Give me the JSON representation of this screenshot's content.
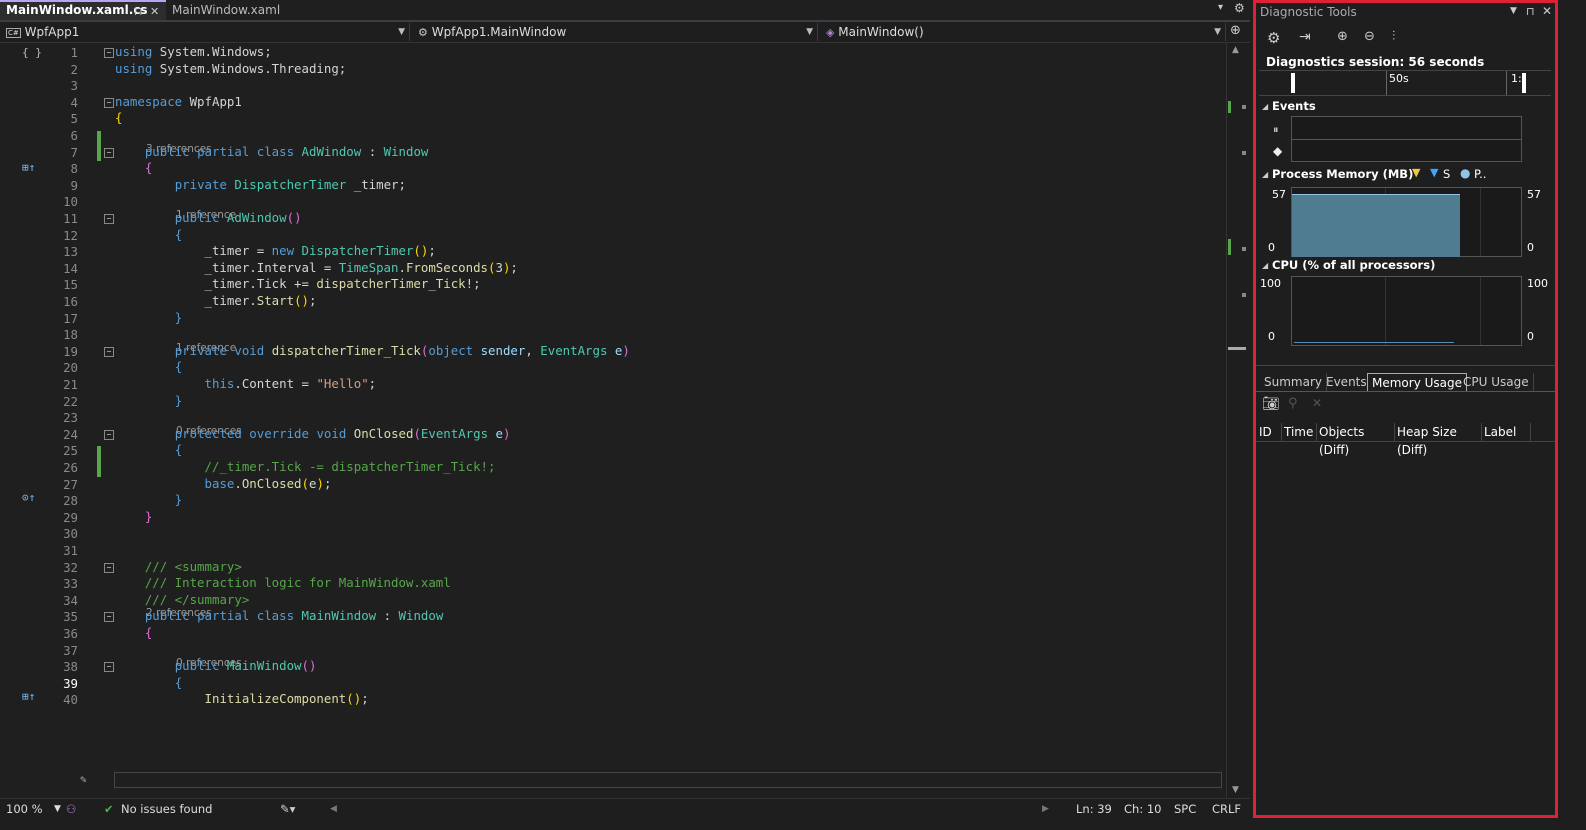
{
  "editor_tabs": [
    {
      "label": "MainWindow.xaml.cs",
      "active": true
    },
    {
      "label": "MainWindow.xaml",
      "active": false
    }
  ],
  "navbar": {
    "project": "WpfApp1",
    "class": "WpfApp1.MainWindow",
    "member": "MainWindow()"
  },
  "code_lines": [
    {
      "n": "1",
      "html": "<span class=\"kw\">using</span> System.Windows;"
    },
    {
      "n": "2",
      "html": "<span class=\"kw\">using</span> System.Windows.Threading;"
    },
    {
      "n": "3",
      "html": ""
    },
    {
      "n": "4",
      "html": "<span class=\"kw\">namespace</span> WpfApp1"
    },
    {
      "n": "5",
      "html": "<span class=\"br1\">{</span>"
    },
    {
      "n": "6",
      "html": ""
    },
    {
      "n": "7",
      "html": "    <span class=\"kw\">public</span> <span class=\"kw\">partial</span> <span class=\"kw\">class</span> <span class=\"ty\">AdWindow</span> : <span class=\"ty\">Window</span>"
    },
    {
      "n": "8",
      "html": "    <span class=\"br2\">{</span>"
    },
    {
      "n": "9",
      "html": "        <span class=\"kw\">private</span> <span class=\"ty\">DispatcherTimer</span> _timer;"
    },
    {
      "n": "10",
      "html": ""
    },
    {
      "n": "11",
      "html": "        <span class=\"kw\">public</span> <span class=\"ty\">AdWindow</span><span class=\"br2\">()</span>"
    },
    {
      "n": "12",
      "html": "        <span class=\"kw\">{</span>"
    },
    {
      "n": "13",
      "html": "            _timer = <span class=\"kw\">new</span> <span class=\"ty\">DispatcherTimer</span><span class=\"br1\">()</span>;"
    },
    {
      "n": "14",
      "html": "            _timer.Interval = <span class=\"ty\">TimeSpan</span>.<span class=\"fn\">FromSeconds</span><span class=\"br1\">(</span>3<span class=\"br1\">)</span>;"
    },
    {
      "n": "15",
      "html": "            _timer.Tick += <span class=\"fn\">dispatcherTimer_Tick</span>!;"
    },
    {
      "n": "16",
      "html": "            _timer.<span class=\"fn\">Start</span><span class=\"br1\">()</span>;"
    },
    {
      "n": "17",
      "html": "        <span class=\"kw\">}</span>"
    },
    {
      "n": "18",
      "html": ""
    },
    {
      "n": "19",
      "html": "        <span class=\"kw\">private</span> <span class=\"kw\">void</span> <span class=\"fn\">dispatcherTimer_Tick</span><span class=\"br2\">(</span><span class=\"kw\">object</span> <span class=\"var\">sender</span>, <span class=\"ty\">EventArgs</span> <span class=\"var\">e</span><span class=\"br2\">)</span>"
    },
    {
      "n": "20",
      "html": "        <span class=\"kw\">{</span>"
    },
    {
      "n": "21",
      "html": "            <span class=\"kw\">this</span>.Content = <span class=\"st\">\"Hello\"</span>;"
    },
    {
      "n": "22",
      "html": "        <span class=\"kw\">}</span>"
    },
    {
      "n": "23",
      "html": ""
    },
    {
      "n": "24",
      "html": "        <span class=\"kw\">protected</span> <span class=\"kw\">override</span> <span class=\"kw\">void</span> <span class=\"fn\">OnClosed</span><span class=\"br2\">(</span><span class=\"ty\">EventArgs</span> <span class=\"var\">e</span><span class=\"br2\">)</span>"
    },
    {
      "n": "25",
      "html": "        <span class=\"kw\">{</span>"
    },
    {
      "n": "26",
      "html": "            <span class=\"cm\">//_timer.Tick -= dispatcherTimer_Tick!;</span>"
    },
    {
      "n": "27",
      "html": "            <span class=\"kw\">base</span>.<span class=\"fn\">OnClosed</span><span class=\"br1\">(</span>e<span class=\"br1\">)</span>;"
    },
    {
      "n": "28",
      "html": "        <span class=\"kw\">}</span>"
    },
    {
      "n": "29",
      "html": "    <span class=\"br2\">}</span>"
    },
    {
      "n": "30",
      "html": ""
    },
    {
      "n": "31",
      "html": ""
    },
    {
      "n": "32",
      "html": "    <span class=\"cm\">/// &lt;summary&gt;</span>"
    },
    {
      "n": "33",
      "html": "    <span class=\"cm\">/// Interaction logic for MainWindow.xaml</span>"
    },
    {
      "n": "34",
      "html": "    <span class=\"cm\">/// &lt;/summary&gt;</span>"
    },
    {
      "n": "35",
      "html": "    <span class=\"kw\">public</span> <span class=\"kw\">partial</span> <span class=\"kw\">class</span> <span class=\"ty\">MainWindow</span> : <span class=\"ty\">Window</span>"
    },
    {
      "n": "36",
      "html": "    <span class=\"br2\">{</span>"
    },
    {
      "n": "37",
      "html": ""
    },
    {
      "n": "38",
      "html": "        <span class=\"kw\">public</span> <span class=\"ty\">MainWindow</span><span class=\"br2\">()</span>"
    },
    {
      "n": "39",
      "html": "        <span class=\"kw\">{</span>"
    },
    {
      "n": "40",
      "html": "            <span class=\"fn\">InitializeComponent</span><span class=\"br1\">()</span>;"
    }
  ],
  "code_lens": [
    {
      "after_line": 6,
      "text": "3 references"
    },
    {
      "after_line": 10,
      "text": "1 reference"
    },
    {
      "after_line": 18,
      "text": "1 reference"
    },
    {
      "after_line": 23,
      "text": "0 references"
    },
    {
      "after_line": 34,
      "text": "2 references"
    },
    {
      "after_line": 37,
      "text": "0 references"
    }
  ],
  "statusbar": {
    "zoom": "100 %",
    "issues": "No issues found",
    "line": "Ln: 39",
    "char": "Ch: 10",
    "spacing": "SPC",
    "eol": "CRLF"
  },
  "diagnostics": {
    "title": "Diagnostic Tools",
    "session": "Diagnostics session: 56 seconds",
    "timeline_tick": "50s",
    "timeline_end": "1:",
    "events_label": "Events",
    "memory_label": "Process Memory (MB)",
    "memory_legend_s": "S",
    "memory_legend_p": "P..",
    "memory_max": "57",
    "memory_min": "0",
    "cpu_label": "CPU (% of all processors)",
    "cpu_max": "100",
    "cpu_min": "0",
    "tabs": [
      "Summary",
      "Events",
      "Memory Usage",
      "CPU Usage"
    ],
    "active_tab": "Memory Usage",
    "columns": [
      "ID",
      "Time",
      "Objects (Diff)",
      "Heap Size (Diff)",
      "Label"
    ],
    "colors": {
      "memory_fill": "#4f7c91",
      "border": "#e02035"
    }
  }
}
